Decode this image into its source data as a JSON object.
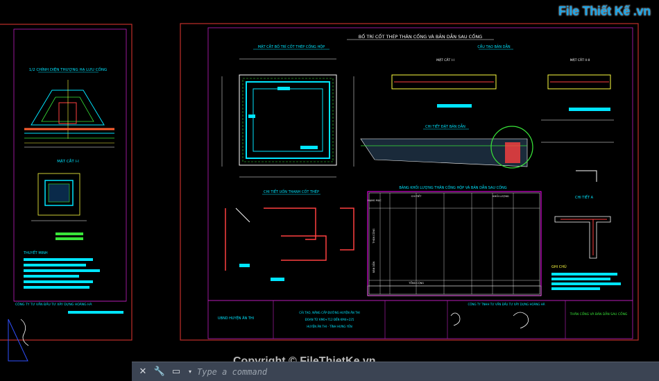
{
  "drawing": {
    "main_title": "BỐ TRÍ CỐT THÉP THÂN CỐNG VÀ BẢN DẪN SAU CỐNG",
    "sec_left": "MẶT CẮT BỐ TRÍ CỐT THÉP CỐNG HỘP",
    "sec_right": "CẤU TẠO BẢN DẪN",
    "sec_approach": "CHI TIẾT ĐẶT BẢN DẪN",
    "sec_bend": "CHI TIẾT UỐN THANH CỐT THÉP",
    "sec_table": "BẢNG KHỐI LƯỢNG THÂN CỐNG HỘP VÀ BẢN DẪN SAU CỐNG",
    "sec_detail_a": "CHI TIẾT A",
    "notes_head": "GHI CHÚ",
    "mc11": "MẶT CẮT I-I",
    "mc22": "MẶT CẮT II-II",
    "left_elev": "1/2 CHÍNH DIỆN THƯỢNG HẠ LƯU CỐNG",
    "left_mc": "MẶT CẮT I-I",
    "left_notes": "THUYẾT MINH",
    "tb_owner": "UBND HUYỆN ÂN THI",
    "tb_project_1": "CẢI TẠO, NÂNG CẤP ĐƯỜNG HUYỆN ÂN THI",
    "tb_project_2": "ĐOẠN TỪ KM0+712 ĐẾN KM4+225",
    "tb_project_3": "HUYỆN ÂN THI - TỈNH HƯNG YÊN",
    "tb_company": "CÔNG TY TNHH TƯ VẤN ĐẦU TƯ XÂY DỰNG HOÀNG HÀ",
    "tb_sheet": "THÂN CỐNG VÀ BẢN DẪN SAU CỐNG",
    "tb_left_company": "CÔNG TY TƯ VẤN ĐẦU TƯ XÂY DỰNG HOÀNG HÀ",
    "table_col_hm": "HẠNG MỤC",
    "table_col_ct": "CHI TIẾT",
    "table_col_kl": "KHỐI LƯỢNG",
    "table_total": "TỔNG CỘNG",
    "table_group1": "THÂN CỐNG",
    "table_group2": "BẢN DẪN"
  },
  "ui": {
    "command_placeholder": "Type a command",
    "close_icon": "close-icon",
    "wrench_icon": "wrench-icon",
    "cmd_icon": "command-line-icon"
  },
  "watermark": {
    "logo_text": "File Thiết Kế .vn",
    "copyright": "Copyright © FileThietKe.vn"
  },
  "colors": {
    "frame": "#c0302a",
    "inner_frame": "#c020c0",
    "cyan": "#00e5ff",
    "green": "#39e639",
    "yellow": "#ffff40",
    "white": "#ffffff",
    "blue": "#3050ff",
    "magenta": "#ff00ff"
  }
}
